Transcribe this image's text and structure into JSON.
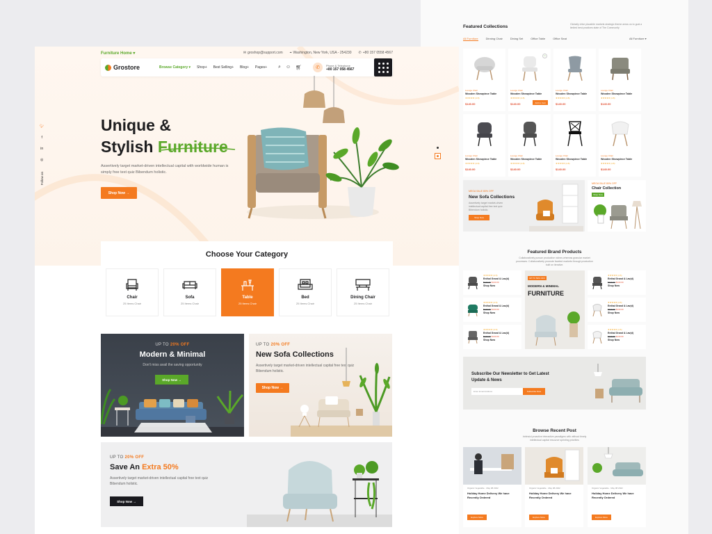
{
  "left": {
    "topbar": {
      "home": "Furniture Home",
      "email": "groshop@support.com",
      "location": "Washington, New York, USA - 254230",
      "phone": "+80 157 0558 4567"
    },
    "nav": {
      "brand": "Grostore",
      "links": [
        "Browse Category",
        "Shop",
        "Best Selling",
        "Blog",
        "Pages"
      ],
      "phone_label": "Phone & Telephone",
      "phone_number": "+80 157 058 4567"
    },
    "social": {
      "follow": "Follow on"
    },
    "hero": {
      "title_1": "Unique &",
      "title_2": "Stylish",
      "title_highlight": "Furniture",
      "desc": "Assertively target market-driven intellectual capital with worldwide human is simply free text quiz Bibendum holistic.",
      "cta": "Shop Now"
    },
    "category": {
      "title": "Choose Your Category",
      "items": [
        {
          "name": "Chair",
          "count": "25 Items Chair"
        },
        {
          "name": "Sofa",
          "count": "25 Items Chair"
        },
        {
          "name": "Table",
          "count": "25 Items Chair"
        },
        {
          "name": "Bed",
          "count": "25 Items Chair"
        },
        {
          "name": "Dining Chair",
          "count": "25 Items Chair"
        }
      ]
    },
    "banners": {
      "b1": {
        "up": "UP TO",
        "pct": "20% OFF",
        "title": "Modern & Minimal",
        "desc": "Don't miss avail the saving opportunity",
        "cta": "Shop Now"
      },
      "b2": {
        "up": "UP TO",
        "pct": "20% OFF",
        "title": "New Sofa Collections",
        "desc": "Assertively target market-driven intellectual capital free text quiz Bibendum holistic.",
        "cta": "Shop Now"
      },
      "b3": {
        "up": "UP TO",
        "pct": "20% OFF",
        "title": "Save An",
        "title_highlight": "Extra 50%",
        "desc": "Assertively target market-driven intellectual capital free text quiz Bibendum holistic.",
        "cta": "Shop Now"
      }
    }
  },
  "right": {
    "featured": {
      "title": "Featured Collections",
      "desc": "Globally drive plausible markets strategic theme areas us to goal a limited best practices state of The Community",
      "tabs": [
        "All Furniture",
        "Dinning Chair",
        "Dining Set",
        "Office Table",
        "Office Seat"
      ],
      "filter": "All Furniture",
      "products": [
        {
          "tag": "Lounge Chair",
          "name": "Wooden Showpiece Table",
          "stars": "★★★★★ (4.8)",
          "price": "$140.00"
        },
        {
          "tag": "Lounge Chair",
          "name": "Wooden Showpiece Table",
          "stars": "★★★★★ (4.8)",
          "price": "$140.00",
          "cart": "Add to Cart"
        },
        {
          "tag": "Lounge Chair",
          "name": "Wooden Showpiece Table",
          "stars": "★★★★★ (4.8)",
          "price": "$140.00"
        },
        {
          "tag": "Lounge Chair",
          "name": "Wooden Showpiece Table",
          "stars": "★★★★★ (4.8)",
          "price": "$140.00"
        },
        {
          "tag": "Lounge Chair",
          "name": "Wooden Showpiece Table",
          "stars": "★★★★★ (4.8)",
          "price": "$140.00"
        },
        {
          "tag": "Lounge Chair",
          "name": "Wooden Showpiece Table",
          "stars": "★★★★★ (4.8)",
          "price": "$140.00"
        },
        {
          "tag": "Lounge Chair",
          "name": "Wooden Showpiece Table",
          "stars": "★★★★★ (4.8)",
          "price": "$140.00"
        },
        {
          "tag": "Lounge Chair",
          "name": "Wooden Showpiece Table",
          "stars": "★★★★★ (4.8)",
          "price": "$140.00"
        }
      ]
    },
    "promo": {
      "sofa": {
        "sale": "MEGA SALE 80% OFF",
        "title": "New Sofa Collections",
        "desc": "Assertively target market-driven intellectual capital free text quiz Bibendum holistic.",
        "cta": "Shop Now"
      },
      "chair": {
        "sale": "MEGA SALE 80% OFF",
        "title": "Chair Collection",
        "cta": "Shop Now"
      }
    },
    "brand": {
      "title": "Featured Brand Products",
      "desc": "Collaboratively pursue productive niches whereas granular market processes. Collaboratively promote faceted markets through production built on iterative.",
      "center_tag": "UP TO 50% OFF",
      "center_title_1": "MODERN & MINIMAL",
      "center_title_2": "FURNITURE",
      "items": [
        {
          "name": "Enthal Grand & Lav(d)",
          "stars": "★★★★★ (4.5)",
          "old": "$340.00",
          "price": "$140.00",
          "cta": "Shop Now"
        },
        {
          "name": "Enthal Grand & Lav(d)",
          "stars": "★★★★★ (4.5)",
          "old": "$340.00",
          "price": "$140.00",
          "cta": "Shop Now"
        },
        {
          "name": "Enthal Grand & Lav(d)",
          "stars": "★★★★★ (4.5)",
          "old": "$340.00",
          "price": "$140.00",
          "cta": "Shop Now"
        },
        {
          "name": "Enthal Grand & Lav(d)",
          "stars": "★★★★★ (4.5)",
          "old": "$340.00",
          "price": "$140.00",
          "cta": "Shop Now"
        },
        {
          "name": "Enthal Grand & Lav(d)",
          "stars": "★★★★★ (4.5)",
          "old": "$340.00",
          "price": "$140.00",
          "cta": "Shop Now"
        },
        {
          "name": "Enthal Grand & Lav(d)",
          "stars": "★★★★★ (4.5)",
          "old": "$340.00",
          "price": "$140.00",
          "cta": "Shop Now"
        }
      ]
    },
    "newsletter": {
      "title": "Subscribe Our Newsletter to Get Latest Update & News",
      "placeholder": "Enter Email Address",
      "cta": "Subscribe Now"
    },
    "blog": {
      "title": "Browse Recent Post",
      "desc": "Intrinsicl proactive interactive paradigms with without timely intellectual capital resource sprinting priorities",
      "posts": [
        {
          "author": "Organic Vegetable",
          "date": "May 08 2022",
          "title": "Holiday Home Delivery We have Recently Ordered",
          "cta": "Explore More"
        },
        {
          "author": "Organic Vegetable",
          "date": "May 08 2022",
          "title": "Holiday Home Delivery We have Recently Ordered",
          "cta": "Explore More"
        },
        {
          "author": "Organic Vegetable",
          "date": "May 08 2022",
          "title": "Holiday Home Delivery We have Recently Ordered",
          "cta": "Explore More"
        }
      ]
    }
  }
}
